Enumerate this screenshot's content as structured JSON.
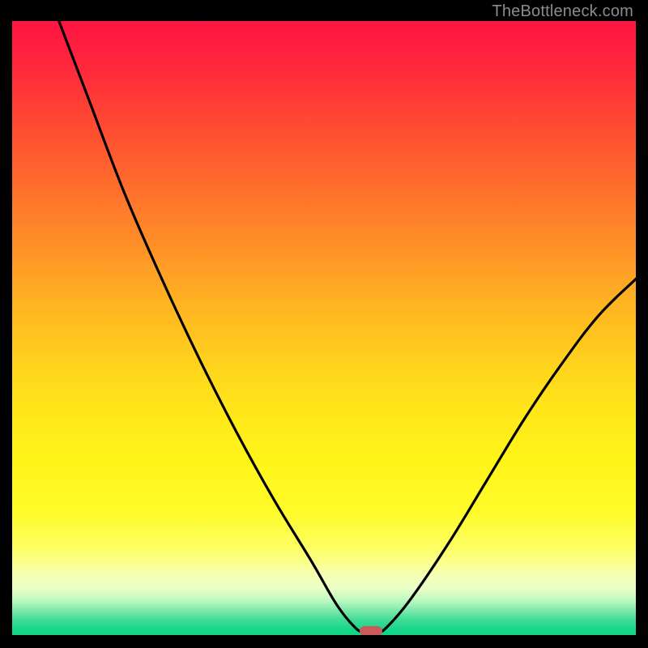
{
  "watermark": "TheBottleneck.com",
  "chart_data": {
    "type": "line",
    "title": "",
    "xlabel": "",
    "ylabel": "",
    "xlim": [
      0,
      100
    ],
    "ylim": [
      0,
      100
    ],
    "curve": {
      "name": "bottleneck-curve",
      "points": [
        {
          "x": 7.5,
          "y": 100
        },
        {
          "x": 12,
          "y": 88
        },
        {
          "x": 18,
          "y": 72
        },
        {
          "x": 24,
          "y": 58
        },
        {
          "x": 30,
          "y": 45
        },
        {
          "x": 36,
          "y": 33
        },
        {
          "x": 42,
          "y": 22
        },
        {
          "x": 48,
          "y": 12
        },
        {
          "x": 52,
          "y": 5
        },
        {
          "x": 55,
          "y": 1.2
        },
        {
          "x": 56.5,
          "y": 0.5
        },
        {
          "x": 58.5,
          "y": 0.5
        },
        {
          "x": 60,
          "y": 1.2
        },
        {
          "x": 64,
          "y": 6
        },
        {
          "x": 70,
          "y": 15
        },
        {
          "x": 76,
          "y": 25
        },
        {
          "x": 82,
          "y": 35
        },
        {
          "x": 88,
          "y": 44
        },
        {
          "x": 94,
          "y": 52
        },
        {
          "x": 100,
          "y": 58
        }
      ]
    },
    "marker": {
      "x": 57.5,
      "y": 0.6,
      "color": "#cc5a5a"
    },
    "background_gradient_stops": [
      "#ff1444",
      "#ff8e28",
      "#fff51a",
      "#12d487"
    ]
  }
}
